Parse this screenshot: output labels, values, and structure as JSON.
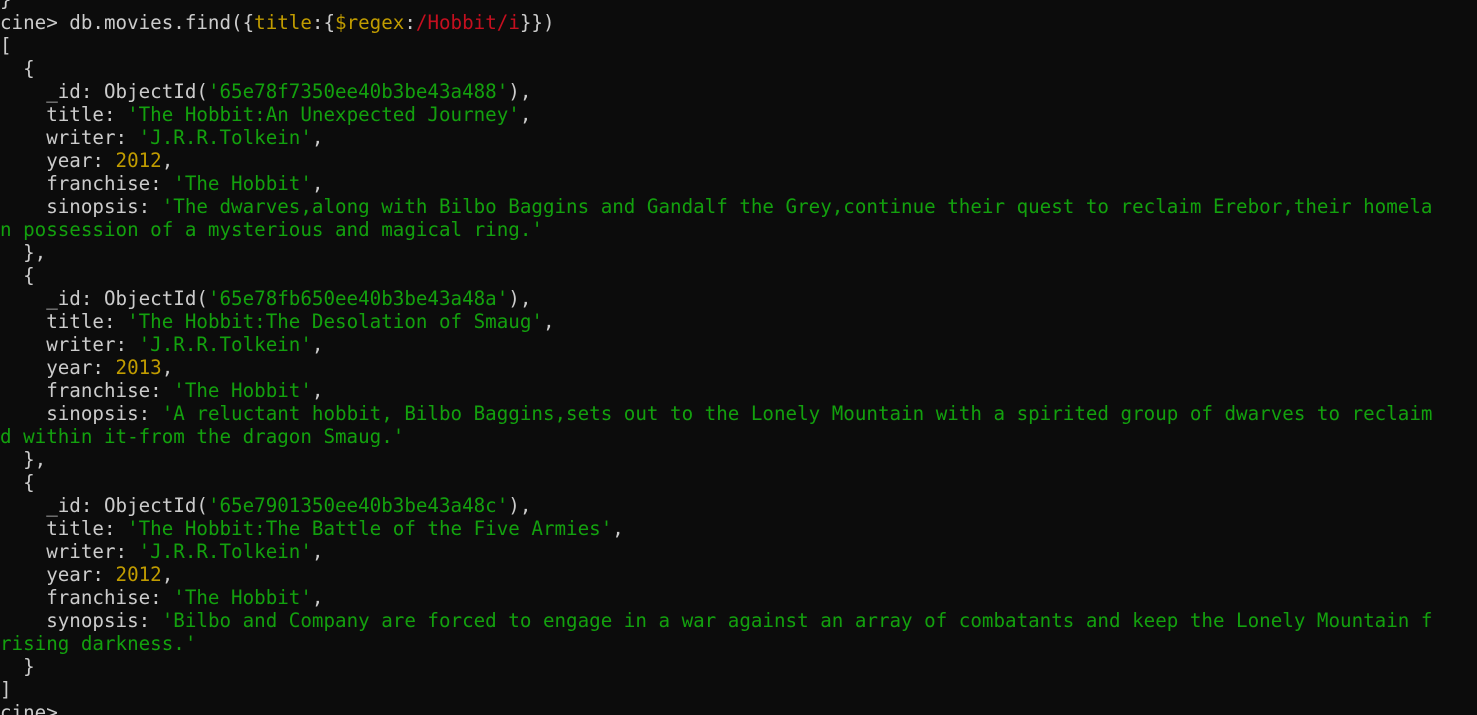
{
  "terminal": {
    "lines": [
      [
        {
          "t": "}",
          "c": "p"
        }
      ],
      [
        {
          "t": "cine> db.movies.find({",
          "c": "p"
        },
        {
          "t": "title",
          "c": "y"
        },
        {
          "t": ":{",
          "c": "p"
        },
        {
          "t": "$regex",
          "c": "y"
        },
        {
          "t": ":",
          "c": "p"
        },
        {
          "t": "/Hobbit/i",
          "c": "r"
        },
        {
          "t": "}})",
          "c": "p"
        }
      ],
      [
        {
          "t": "[",
          "c": "p"
        }
      ],
      [
        {
          "t": "  {",
          "c": "p"
        }
      ],
      [
        {
          "t": "    _id: ObjectId(",
          "c": "p"
        },
        {
          "t": "'65e78f7350ee40b3be43a488'",
          "c": "s2"
        },
        {
          "t": "),",
          "c": "p"
        }
      ],
      [
        {
          "t": "    title: ",
          "c": "p"
        },
        {
          "t": "'The Hobbit:An Unexpected Journey'",
          "c": "s2"
        },
        {
          "t": ",",
          "c": "p"
        }
      ],
      [
        {
          "t": "    writer: ",
          "c": "p"
        },
        {
          "t": "'J.R.R.Tolkein'",
          "c": "s2"
        },
        {
          "t": ",",
          "c": "p"
        }
      ],
      [
        {
          "t": "    year: ",
          "c": "p"
        },
        {
          "t": "2012",
          "c": "n"
        },
        {
          "t": ",",
          "c": "p"
        }
      ],
      [
        {
          "t": "    franchise: ",
          "c": "p"
        },
        {
          "t": "'The Hobbit'",
          "c": "s2"
        },
        {
          "t": ",",
          "c": "p"
        }
      ],
      [
        {
          "t": "    sinopsis: ",
          "c": "p"
        },
        {
          "t": "'The dwarves,along with Bilbo Baggins and Gandalf the Grey,continue their quest to reclaim Erebor,their homela",
          "c": "s2"
        }
      ],
      [
        {
          "t": "n possession of a mysterious and magical ring.'",
          "c": "s2"
        }
      ],
      [
        {
          "t": "  },",
          "c": "p"
        }
      ],
      [
        {
          "t": "  {",
          "c": "p"
        }
      ],
      [
        {
          "t": "    _id: ObjectId(",
          "c": "p"
        },
        {
          "t": "'65e78fb650ee40b3be43a48a'",
          "c": "s2"
        },
        {
          "t": "),",
          "c": "p"
        }
      ],
      [
        {
          "t": "    title: ",
          "c": "p"
        },
        {
          "t": "'The Hobbit:The Desolation of Smaug'",
          "c": "s2"
        },
        {
          "t": ",",
          "c": "p"
        }
      ],
      [
        {
          "t": "    writer: ",
          "c": "p"
        },
        {
          "t": "'J.R.R.Tolkein'",
          "c": "s2"
        },
        {
          "t": ",",
          "c": "p"
        }
      ],
      [
        {
          "t": "    year: ",
          "c": "p"
        },
        {
          "t": "2013",
          "c": "n"
        },
        {
          "t": ",",
          "c": "p"
        }
      ],
      [
        {
          "t": "    franchise: ",
          "c": "p"
        },
        {
          "t": "'The Hobbit'",
          "c": "s2"
        },
        {
          "t": ",",
          "c": "p"
        }
      ],
      [
        {
          "t": "    sinopsis: ",
          "c": "p"
        },
        {
          "t": "'A reluctant hobbit, Bilbo Baggins,sets out to the Lonely Mountain with a spirited group of dwarves to reclaim",
          "c": "s2"
        }
      ],
      [
        {
          "t": "d within it-from the dragon Smaug.'",
          "c": "s2"
        }
      ],
      [
        {
          "t": "  },",
          "c": "p"
        }
      ],
      [
        {
          "t": "  {",
          "c": "p"
        }
      ],
      [
        {
          "t": "    _id: ObjectId(",
          "c": "p"
        },
        {
          "t": "'65e7901350ee40b3be43a48c'",
          "c": "s2"
        },
        {
          "t": "),",
          "c": "p"
        }
      ],
      [
        {
          "t": "    title: ",
          "c": "p"
        },
        {
          "t": "'The Hobbit:The Battle of the Five Armies'",
          "c": "s2"
        },
        {
          "t": ",",
          "c": "p"
        }
      ],
      [
        {
          "t": "    writer: ",
          "c": "p"
        },
        {
          "t": "'J.R.R.Tolkein'",
          "c": "s2"
        },
        {
          "t": ",",
          "c": "p"
        }
      ],
      [
        {
          "t": "    year: ",
          "c": "p"
        },
        {
          "t": "2012",
          "c": "n"
        },
        {
          "t": ",",
          "c": "p"
        }
      ],
      [
        {
          "t": "    franchise: ",
          "c": "p"
        },
        {
          "t": "'The Hobbit'",
          "c": "s2"
        },
        {
          "t": ",",
          "c": "p"
        }
      ],
      [
        {
          "t": "    synopsis: ",
          "c": "p"
        },
        {
          "t": "'Bilbo and Company are forced to engage in a war against an array of combatants and keep the Lonely Mountain f",
          "c": "s2"
        }
      ],
      [
        {
          "t": "rising darkness.'",
          "c": "s2"
        }
      ],
      [
        {
          "t": "  }",
          "c": "p"
        }
      ],
      [
        {
          "t": "]",
          "c": "p"
        }
      ],
      [
        {
          "t": "cine> ",
          "c": "p"
        }
      ]
    ]
  },
  "colors": {
    "background": "#0c0c0c",
    "default_text": "#cccccc",
    "string": "#13a10e",
    "number": "#c19c00",
    "regex": "#c50f1f"
  }
}
